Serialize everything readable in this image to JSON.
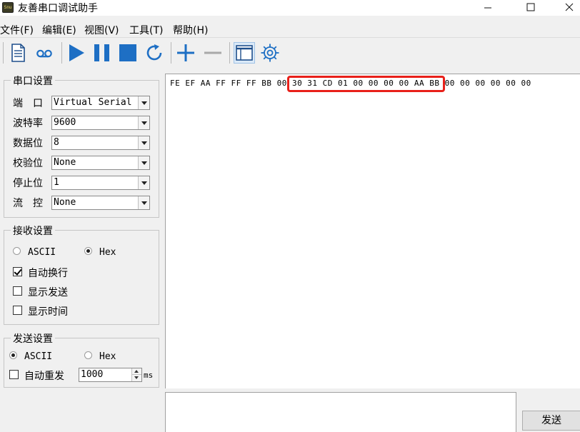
{
  "window": {
    "title": "友善串口调试助手",
    "icon_text": "Snu"
  },
  "menu": [
    {
      "label": "文件(F)"
    },
    {
      "label": "编辑(E)"
    },
    {
      "label": "视图(V)"
    },
    {
      "label": "工具(T)"
    },
    {
      "label": "帮助(H)"
    }
  ],
  "toolbar_icons": [
    "document-icon",
    "record-icon",
    "play-icon",
    "pause-icon",
    "stop-icon",
    "refresh-icon",
    "plus-icon",
    "minus-icon",
    "window-icon",
    "gear-icon"
  ],
  "colors": {
    "accent": "#1e6fc4",
    "highlight": "#e8201a"
  },
  "serial": {
    "title": "串口设置",
    "fields": [
      {
        "label": "端　口",
        "value": "Virtual Serial"
      },
      {
        "label": "波特率",
        "value": "9600"
      },
      {
        "label": "数据位",
        "value": "8"
      },
      {
        "label": "校验位",
        "value": "None"
      },
      {
        "label": "停止位",
        "value": "1"
      },
      {
        "label": "流　控",
        "value": "None"
      }
    ]
  },
  "receive": {
    "title": "接收设置",
    "ascii_label": "ASCII",
    "hex_label": "Hex",
    "mode_selected": "Hex",
    "options": [
      {
        "label": "自动换行",
        "checked": true
      },
      {
        "label": "显示发送",
        "checked": false
      },
      {
        "label": "显示时间",
        "checked": false
      }
    ]
  },
  "send": {
    "title": "发送设置",
    "ascii_label": "ASCII",
    "hex_label": "Hex",
    "mode_selected": "ASCII",
    "auto_resend_label": "自动重发",
    "auto_resend_checked": false,
    "interval": "1000",
    "unit": "ms",
    "button_label": "发送"
  },
  "received_text": "FE EF AA FF FF FF BB 00 30 31 CD 01 00 00 00 00 AA BB 00 00 00 00 00 00"
}
